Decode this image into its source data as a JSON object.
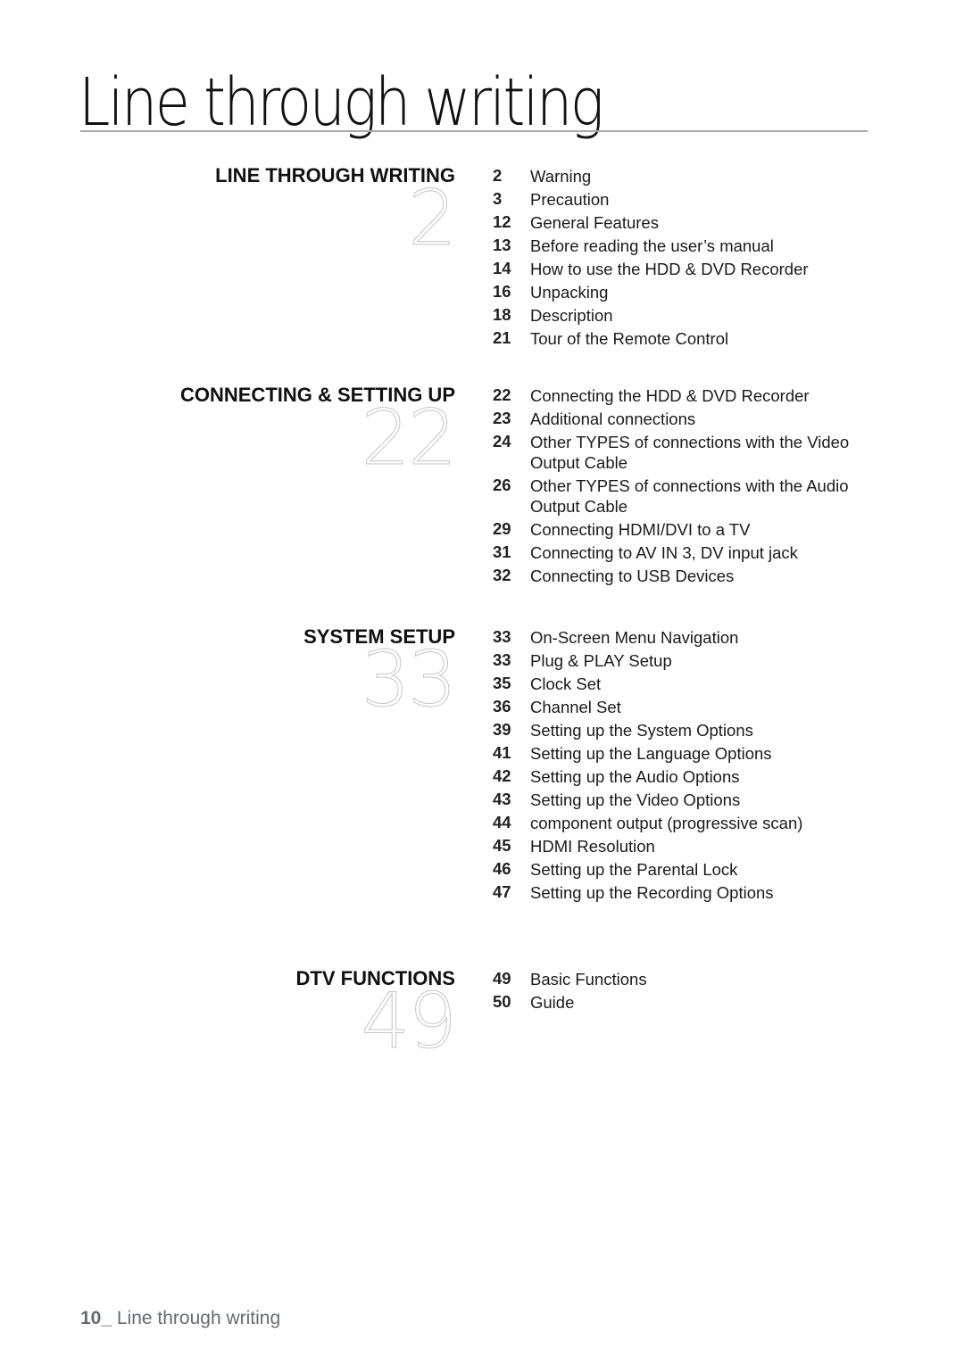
{
  "page": {
    "title": "Line through writing"
  },
  "sections": [
    {
      "heading": "LINE THROUGH WRITING",
      "start_page": "2",
      "entries": [
        {
          "page": "2",
          "title": "Warning"
        },
        {
          "page": "3",
          "title": "Precaution"
        },
        {
          "page": "12",
          "title": "General Features"
        },
        {
          "page": "13",
          "title": "Before reading the user’s manual"
        },
        {
          "page": "14",
          "title": "How to use the HDD & DVD Recorder"
        },
        {
          "page": "16",
          "title": "Unpacking"
        },
        {
          "page": "18",
          "title": "Description"
        },
        {
          "page": "21",
          "title": "Tour of the Remote Control"
        }
      ]
    },
    {
      "heading": "CONNECTING & SETTING UP",
      "start_page": "22",
      "entries": [
        {
          "page": "22",
          "title": "Connecting the HDD & DVD Recorder"
        },
        {
          "page": "23",
          "title": "Additional connections"
        },
        {
          "page": "24",
          "title": "Other TYPES of connections with the Video Output Cable"
        },
        {
          "page": "26",
          "title": "Other TYPES of connections with the Audio Output Cable"
        },
        {
          "page": "29",
          "title": "Connecting HDMI/DVI to a TV"
        },
        {
          "page": "31",
          "title": "Connecting to AV IN 3, DV input jack"
        },
        {
          "page": "32",
          "title": "Connecting to USB Devices"
        }
      ]
    },
    {
      "heading": "SYSTEM SETUP",
      "start_page": "33",
      "entries": [
        {
          "page": "33",
          "title": "On-Screen Menu Navigation"
        },
        {
          "page": "33",
          "title": "Plug & PLAY Setup"
        },
        {
          "page": "35",
          "title": "Clock Set"
        },
        {
          "page": "36",
          "title": "Channel Set"
        },
        {
          "page": "39",
          "title": "Setting up the System Options"
        },
        {
          "page": "41",
          "title": "Setting up the Language Options"
        },
        {
          "page": "42",
          "title": "Setting up the Audio Options"
        },
        {
          "page": "43",
          "title": "Setting up the Video Options"
        },
        {
          "page": "44",
          "title": "component output (progressive scan)"
        },
        {
          "page": "45",
          "title": "HDMI Resolution"
        },
        {
          "page": "46",
          "title": "Setting up the Parental Lock"
        },
        {
          "page": "47",
          "title": "Setting up the Recording Options"
        }
      ]
    },
    {
      "heading": "DTV FUNCTIONS",
      "start_page": "49",
      "entries": [
        {
          "page": "49",
          "title": "Basic Functions"
        },
        {
          "page": "50",
          "title": "Guide"
        }
      ]
    }
  ],
  "footer": {
    "page_number": "10_",
    "text": " Line through writing"
  }
}
